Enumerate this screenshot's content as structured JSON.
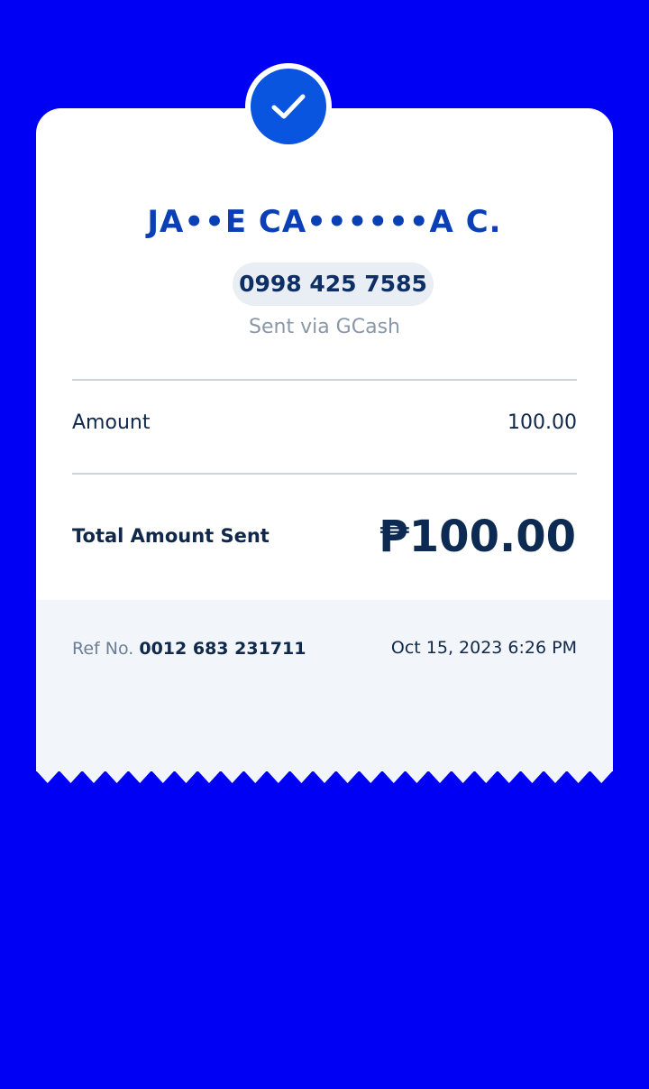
{
  "colors": {
    "background": "#0000f5",
    "card": "#ffffff",
    "footer": "#f2f6fa",
    "accent": "#0a55e0",
    "name_text": "#0a3fb5",
    "dark_text": "#10284a",
    "muted_text": "#8a97a8"
  },
  "status_icon": "check-icon",
  "recipient": {
    "name": "JA••E CA••••••A C.",
    "phone": "0998 425 7585",
    "sent_via": "Sent via GCash"
  },
  "amount": {
    "label": "Amount",
    "value": "100.00"
  },
  "total": {
    "label": "Total Amount Sent",
    "value": "₱100.00"
  },
  "reference": {
    "label": "Ref No.",
    "number": "0012 683 231711",
    "datetime": "Oct 15, 2023 6:26 PM"
  }
}
